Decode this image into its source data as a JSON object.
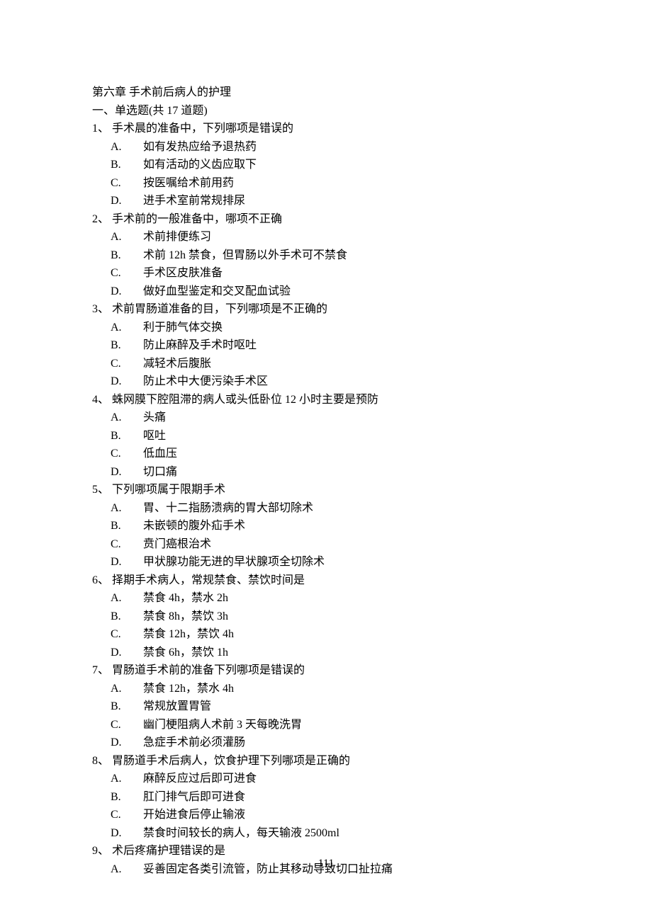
{
  "title": "第六章 手术前后病人的护理",
  "section": "一、单选题(共 17 道题)",
  "questions": [
    {
      "num": "1、",
      "stem": "手术晨的准备中，下列哪项是错误的",
      "options": [
        {
          "label": "A.",
          "text": "如有发热应给予退热药"
        },
        {
          "label": "B.",
          "text": "如有活动的义齿应取下"
        },
        {
          "label": "C.",
          "text": "按医嘱给术前用药"
        },
        {
          "label": "D.",
          "text": "进手术室前常规排尿"
        }
      ]
    },
    {
      "num": "2、",
      "stem": "手术前的一般准备中，哪项不正确",
      "options": [
        {
          "label": "A.",
          "text": "术前排便练习"
        },
        {
          "label": "B.",
          "text": "术前 12h 禁食，但胃肠以外手术可不禁食"
        },
        {
          "label": "C.",
          "text": "手术区皮肤准备"
        },
        {
          "label": "D.",
          "text": "做好血型鉴定和交叉配血试验"
        }
      ]
    },
    {
      "num": "3、",
      "stem": "术前胃肠道准备的目，下列哪项是不正确的",
      "options": [
        {
          "label": "A.",
          "text": "利于肺气体交换"
        },
        {
          "label": "B.",
          "text": "防止麻醉及手术时呕吐"
        },
        {
          "label": "C.",
          "text": "减轻术后腹胀"
        },
        {
          "label": "D.",
          "text": "防止术中大便污染手术区"
        }
      ]
    },
    {
      "num": "4、",
      "stem": "蛛网膜下腔阻滞的病人或头低卧位 12 小时主要是预防",
      "options": [
        {
          "label": "A.",
          "text": "头痛"
        },
        {
          "label": "B.",
          "text": "呕吐"
        },
        {
          "label": "C.",
          "text": "低血压"
        },
        {
          "label": "D.",
          "text": "切口痛"
        }
      ]
    },
    {
      "num": "5、",
      "stem": "下列哪项属于限期手术",
      "options": [
        {
          "label": "A.",
          "text": "胃、十二指肠溃病的胃大部切除术"
        },
        {
          "label": "B.",
          "text": "未嵌顿的腹外疝手术"
        },
        {
          "label": "C.",
          "text": "贲门癌根治术"
        },
        {
          "label": "D.",
          "text": "甲状腺功能无进的早状腺项全切除术"
        }
      ]
    },
    {
      "num": "6、",
      "stem": "择期手术病人，常规禁食、禁饮时间是",
      "options": [
        {
          "label": "A.",
          "text": "禁食 4h，禁水 2h"
        },
        {
          "label": "B.",
          "text": "禁食 8h，禁饮 3h"
        },
        {
          "label": "C.",
          "text": "禁食 12h，禁饮 4h"
        },
        {
          "label": "D.",
          "text": "禁食 6h，禁饮 1h"
        }
      ]
    },
    {
      "num": "7、",
      "stem": "胃肠道手术前的准备下列哪项是错误的",
      "options": [
        {
          "label": "A.",
          "text": "禁食 12h，禁水 4h"
        },
        {
          "label": "B.",
          "text": "常规放置胃管"
        },
        {
          "label": "C.",
          "text": "幽门梗阻病人术前 3 天每晚洗胃"
        },
        {
          "label": "D.",
          "text": "急症手术前必须灌肠"
        }
      ]
    },
    {
      "num": "8、",
      "stem": "胃肠道手术后病人，饮食护理下列哪项是正确的",
      "options": [
        {
          "label": "A.",
          "text": "麻醉反应过后即可进食"
        },
        {
          "label": "B.",
          "text": "肛门排气后即可进食"
        },
        {
          "label": "C.",
          "text": "开始进食后停止输液"
        },
        {
          "label": "D.",
          "text": "禁食时间较长的病人，每天输液 2500ml"
        }
      ]
    },
    {
      "num": "9、",
      "stem": "术后疼痛护理错误的是",
      "options": [
        {
          "label": "A.",
          "text": "妥善固定各类引流管，防止其移动导致切口扯拉痛"
        }
      ]
    }
  ],
  "pageNumber": "111"
}
